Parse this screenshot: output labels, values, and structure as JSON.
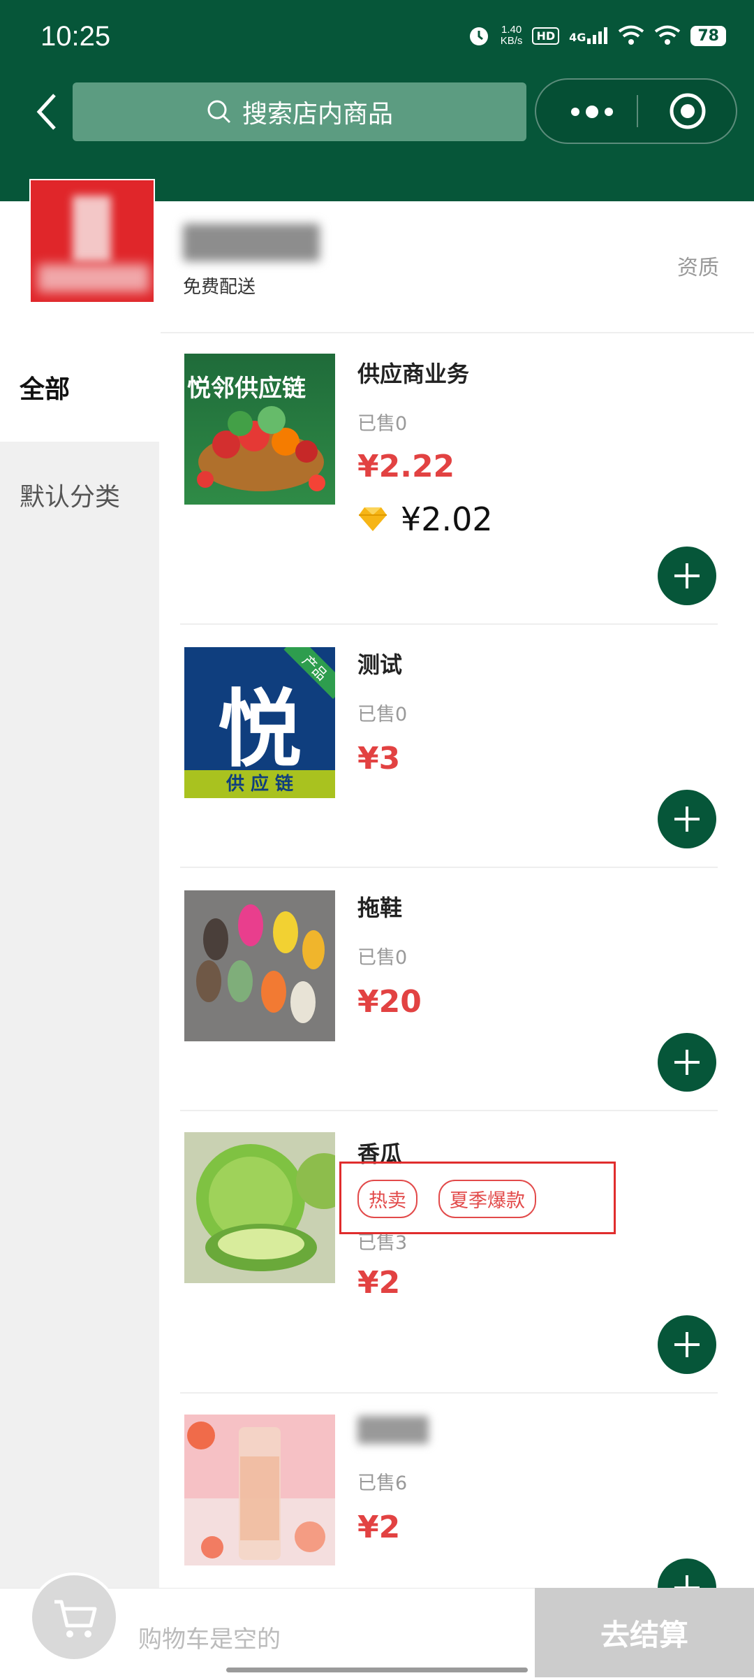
{
  "status_bar": {
    "time": "10:25",
    "net_speed_value": "1.40",
    "net_speed_unit": "KB/s",
    "hd": "HD",
    "signal": "4G",
    "battery": "78"
  },
  "header": {
    "search_placeholder": "搜索店内商品"
  },
  "store": {
    "delivery": "免费配送",
    "qualification": "资质"
  },
  "sidebar": {
    "items": [
      {
        "label": "全部"
      },
      {
        "label": "默认分类"
      }
    ]
  },
  "products": [
    {
      "name": "供应商业务",
      "sold": "已售0",
      "price": "¥2.22",
      "vip_price": "¥2.02",
      "image_text": "悦邻供应链"
    },
    {
      "name": "测试",
      "sold": "已售0",
      "price": "¥3",
      "image_big": "悦",
      "image_corner": "产品",
      "image_bottom": "供 应 链"
    },
    {
      "name": "拖鞋",
      "sold": "已售0",
      "price": "¥20"
    },
    {
      "name": "香瓜",
      "sold": "已售3",
      "price": "¥2",
      "tags": [
        "热卖",
        "夏季爆款"
      ]
    },
    {
      "name": "",
      "sold": "已售6",
      "price": "¥2"
    }
  ],
  "cart": {
    "empty_text": "购物车是空的",
    "checkout_label": "去结算"
  },
  "colors": {
    "brand_green": "#065639",
    "price_red": "#e24242"
  }
}
